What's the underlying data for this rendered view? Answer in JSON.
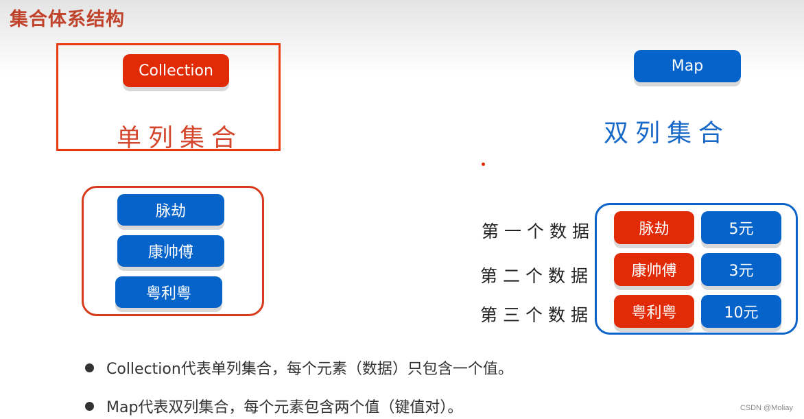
{
  "page": {
    "title": "集合体系结构"
  },
  "collection": {
    "label": "Collection",
    "caption": "单列集合",
    "items": [
      "脉劫",
      "康帅傅",
      "粤利粤"
    ]
  },
  "map": {
    "label": "Map",
    "caption": "双列集合",
    "entries": [
      {
        "row_label": "第一个数据",
        "key": "脉劫",
        "value": "5元"
      },
      {
        "row_label": "第二个数据",
        "key": "康帅傅",
        "value": "3元"
      },
      {
        "row_label": "第三个数据",
        "key": "粤利粤",
        "value": "10元"
      }
    ]
  },
  "notes": [
    "Collection代表单列集合，每个元素（数据）只包含一个值。",
    "Map代表双列集合，每个元素包含两个值（键值对）。"
  ],
  "colors": {
    "collection_accent": "#e12a06",
    "map_accent": "#0563c9",
    "title": "#c0432b"
  },
  "watermark": "CSDN @Moliay"
}
